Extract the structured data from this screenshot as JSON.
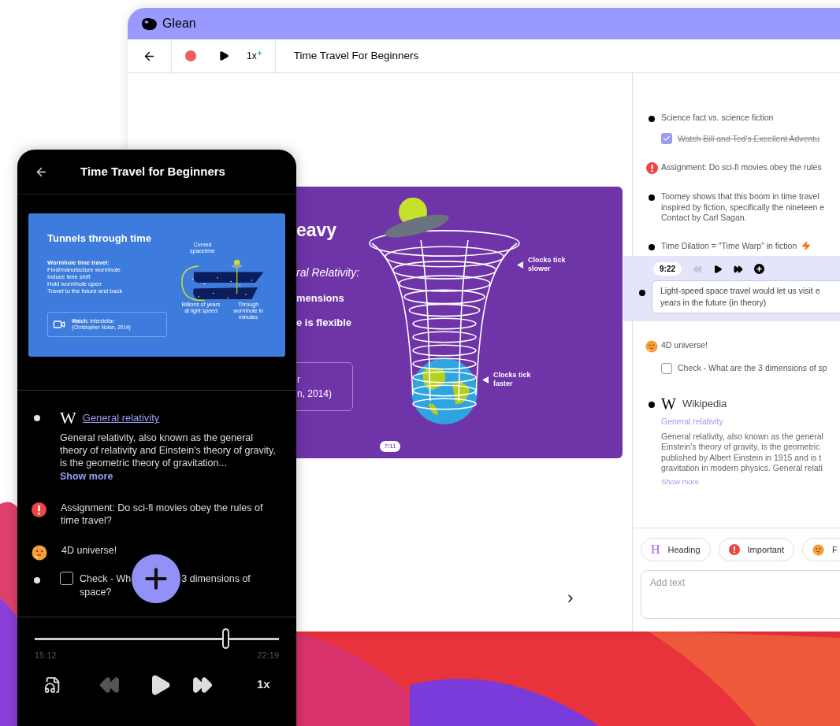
{
  "desktop": {
    "app_name": "Glean",
    "toolbar": {
      "speed": "1x",
      "title": "Time Travel For Beginners"
    },
    "slide": {
      "heading": "eavy",
      "lines": [
        {
          "text": "ral Relativity:",
          "kind": "italic"
        },
        {
          "text": "mensions",
          "kind": "bold"
        },
        {
          "text": "e is flexible",
          "kind": "bold"
        }
      ],
      "watch_lines": [
        "r",
        "n, 2014)"
      ],
      "labels": [
        "Clocks tick slower",
        "Clocks tick faster"
      ],
      "page": "7/11"
    },
    "notes": [
      {
        "kind": "bullet",
        "text": "Science fact vs. science fiction",
        "flash": false,
        "children": [
          {
            "kind": "check",
            "checked": true,
            "text": "Watch Bill and Ted's Excellent Adventu"
          }
        ]
      },
      {
        "kind": "important",
        "text": "Assignment: Do sci-fi movies obey the rules"
      },
      {
        "kind": "bullet",
        "flash": false,
        "lines": [
          "Toomey shows that this boom in time travel",
          "inspired by fiction, specifically the nineteen e",
          "Contact by Carl Sagan."
        ]
      },
      {
        "kind": "bullet",
        "flash": true,
        "text": "Time Dilation = \"Time Warp\" in fiction"
      },
      {
        "kind": "active",
        "time": "9:22",
        "rewind_enabled": false,
        "lines": [
          "Light-speed space travel would let us visit e",
          "years in the future (in theory)"
        ]
      },
      {
        "kind": "thought",
        "text": "4D universe!",
        "children": [
          {
            "kind": "check",
            "checked": false,
            "text": "Check - What are the 3 dimensions of sp"
          }
        ]
      },
      {
        "kind": "wiki",
        "logo": "W",
        "source": "Wikipedia",
        "link": "General relativity",
        "lines": [
          "General relativity, also known as the general",
          "Einstein's theory of gravity, is the geometric",
          "published by Albert Einstein in 1915 and is t",
          "gravitation in modern physics. General relati"
        ],
        "more": "Show more"
      }
    ],
    "tags": [
      {
        "kind": "heading",
        "icon": "H",
        "label": "Heading"
      },
      {
        "kind": "important",
        "label": "Important"
      },
      {
        "kind": "thought",
        "label": "F"
      }
    ],
    "input": {
      "placeholder": "Add text"
    }
  },
  "phone": {
    "title": "Time Travel for Beginners",
    "slide": {
      "title": "Tunnels through time",
      "subtitle": "Wormhole time travel:",
      "steps": [
        "Find/manufacture wormhole",
        "Induce time shift",
        "Hold wormhole open",
        "Travel to the future and back"
      ],
      "diagram_labels": [
        "Curved spacetime",
        "Billions of years at light speed",
        "Through wormhole in minutes"
      ],
      "watch": [
        "**Watch:** Interstellar",
        "(Christopher Nolan, 2014)"
      ]
    },
    "notes": [
      {
        "kind": "wiki",
        "logo": "W",
        "link": "General relativity",
        "text": "General relativity, also known as the general theory of relativity and Einstein's theory of gravity, is the geometric theory of gravitation...",
        "more": "Show more"
      },
      {
        "kind": "important",
        "text": "Assignment: Do sci-fi movies obey the rules of time travel?"
      },
      {
        "kind": "thought",
        "text": "4D universe!"
      },
      {
        "kind": "check",
        "checked": false,
        "parts": [
          "Check - Wh",
          "3 dimensions of",
          "space?"
        ]
      }
    ],
    "player": {
      "level": 0.78,
      "elapsed": "15:12",
      "total": "22:19",
      "rewind_enabled": false,
      "speed": "1x"
    }
  }
}
